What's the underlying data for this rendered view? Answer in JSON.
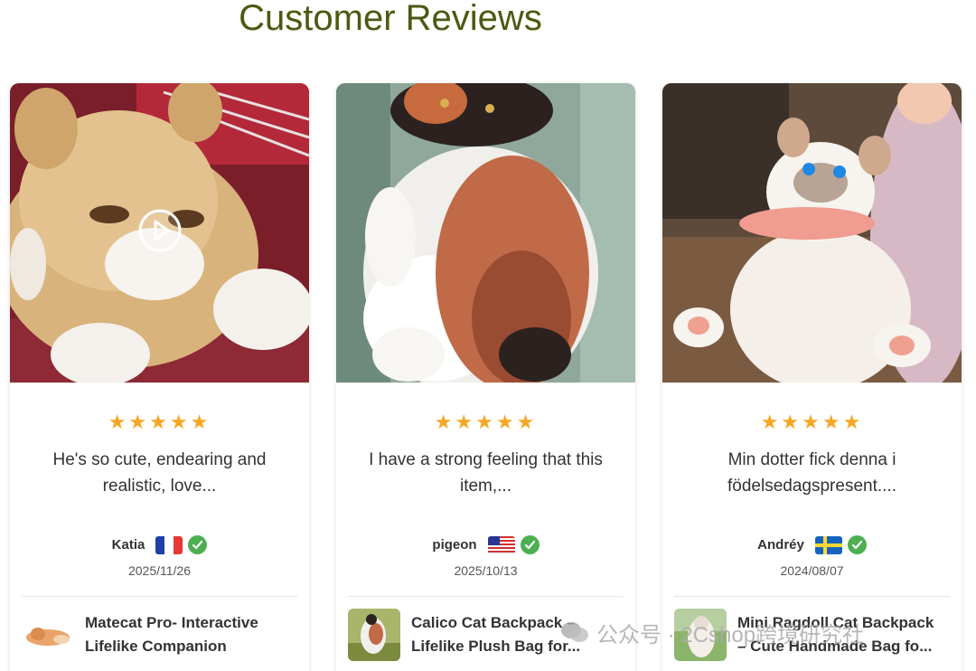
{
  "section_title": "Customer Reviews",
  "reviews": [
    {
      "rating": 5,
      "stars": "★★★★★",
      "text": "He's so cute, endearing and realistic, love...",
      "author": "Katia",
      "country": "France",
      "verified": true,
      "date": "2025/11/26",
      "has_video": true,
      "product_line1": "Matecat Pro- Interactive",
      "product_line2": "Lifelike Companion"
    },
    {
      "rating": 5,
      "stars": "★★★★★",
      "text": "I have a strong feeling that this item,...",
      "author": "pigeon",
      "country": "United States",
      "verified": true,
      "date": "2025/10/13",
      "has_video": false,
      "product_line1": "Calico Cat Backpack –",
      "product_line2": "Lifelike Plush Bag for..."
    },
    {
      "rating": 5,
      "stars": "★★★★★",
      "text": "Min dotter fick denna i födelsedagspresent....",
      "author": "Andréy",
      "country": "Sweden",
      "verified": true,
      "date": "2024/08/07",
      "has_video": false,
      "product_line1": "Mini Ragdoll Cat Backpack",
      "product_line2": "– Cute Handmade Bag fo..."
    }
  ],
  "watermark": "公众号 · 2Cshop跨境研究社",
  "colors": {
    "title": "#4a5a12",
    "star": "#f5a623",
    "verified": "#4caf50"
  }
}
